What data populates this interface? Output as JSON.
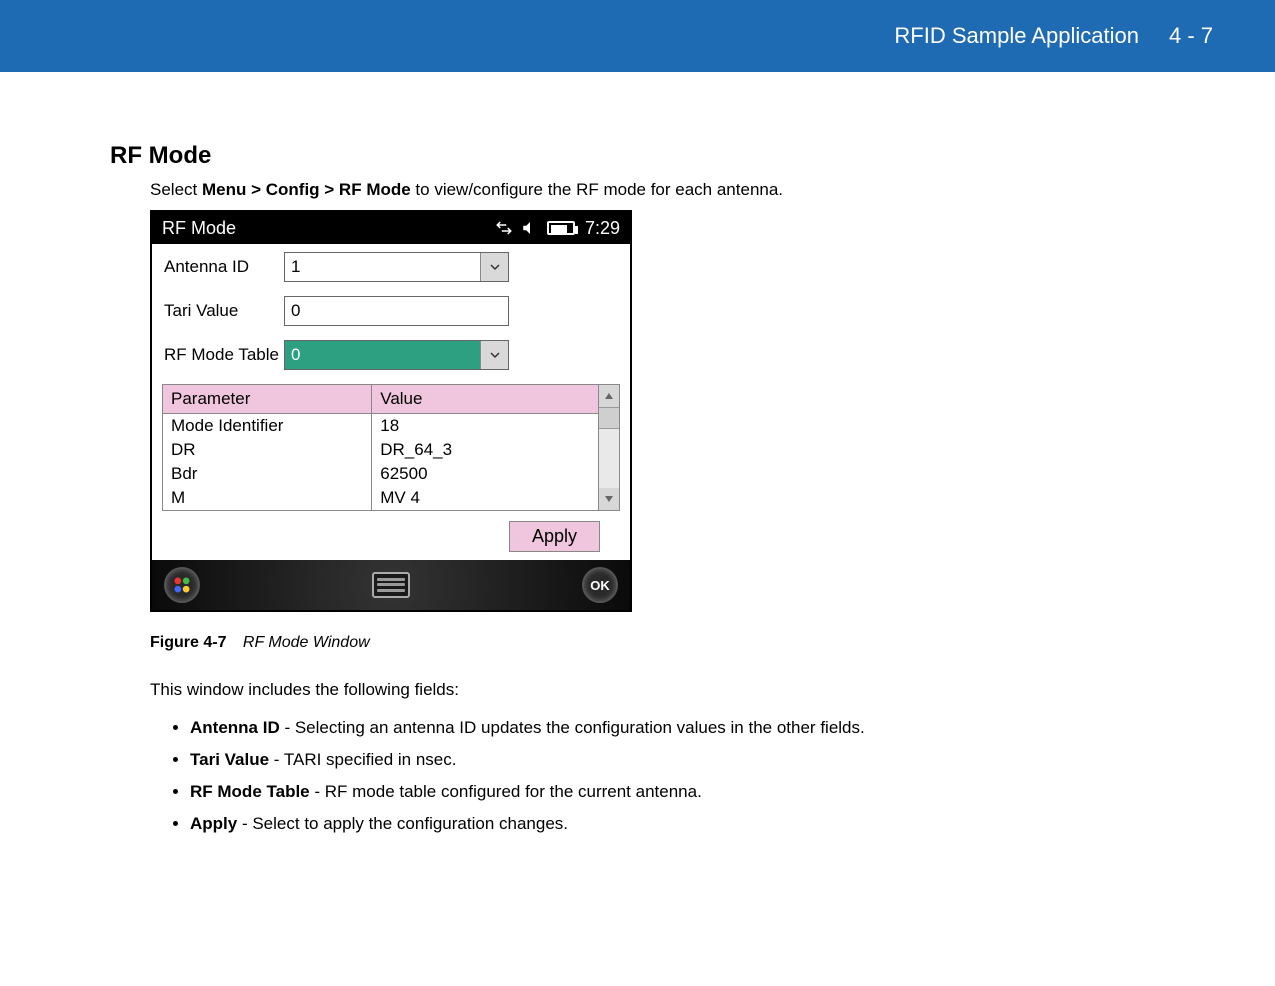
{
  "header": {
    "title": "RFID Sample Application",
    "page": "4 - 7"
  },
  "section": {
    "heading": "RF Mode",
    "intro_prefix": "Select ",
    "intro_bold": "Menu > Config > RF Mode",
    "intro_suffix": " to view/configure the RF mode for each antenna."
  },
  "device": {
    "title": "RF Mode",
    "time": "7:29",
    "fields": {
      "antenna_label": "Antenna ID",
      "antenna_value": "1",
      "tari_label": "Tari Value",
      "tari_value": "0",
      "rfmode_label": "RF Mode Table",
      "rfmode_value": "0"
    },
    "table": {
      "headers": {
        "param": "Parameter",
        "value": "Value"
      },
      "rows": [
        {
          "p": "Mode Identifier",
          "v": "18"
        },
        {
          "p": "DR",
          "v": "DR_64_3"
        },
        {
          "p": "Bdr",
          "v": "62500"
        },
        {
          "p": "M",
          "v": "MV 4"
        }
      ]
    },
    "apply": "Apply",
    "ok": "OK"
  },
  "figure": {
    "label": "Figure 4-7",
    "title": "RF Mode Window"
  },
  "description": "This window includes the following fields:",
  "bullets": [
    {
      "label": "Antenna ID",
      "text": " - Selecting an antenna ID updates the configuration values in the other fields."
    },
    {
      "label": "Tari Value",
      "text": " - TARI specified in nsec."
    },
    {
      "label": "RF Mode Table",
      "text": " - RF mode table configured for the current antenna."
    },
    {
      "label": "Apply",
      "text": " - Select to apply the configuration changes."
    }
  ]
}
